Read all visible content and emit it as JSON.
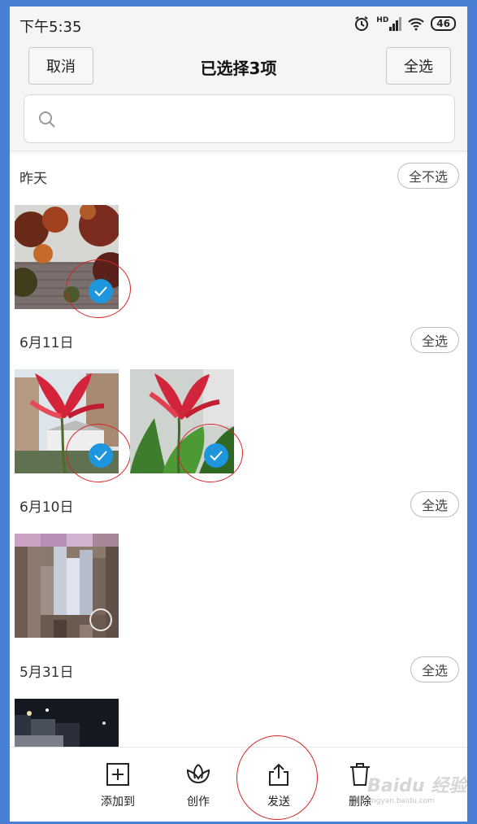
{
  "status": {
    "time": "下午5:35",
    "hd": "HD",
    "battery": "46"
  },
  "header": {
    "cancel": "取消",
    "title": "已选择3项",
    "select_all": "全选"
  },
  "search": {
    "placeholder": ""
  },
  "sections": [
    {
      "label": "昨天",
      "action": "全不选",
      "selected": [
        true
      ]
    },
    {
      "label": "6月11日",
      "action": "全选",
      "selected": [
        true,
        true
      ]
    },
    {
      "label": "6月10日",
      "action": "全选",
      "selected": [
        false
      ]
    },
    {
      "label": "5月31日",
      "action": "全选",
      "selected": []
    }
  ],
  "toolbar": {
    "add_to": "添加到",
    "create": "创作",
    "send": "发送",
    "delete": "删除"
  },
  "watermark": {
    "brand": "Baidu 经验",
    "url": "jingyan.baidu.com"
  },
  "colors": {
    "check": "#1e96de",
    "annotation": "#d62424",
    "background": "#4a7fd6"
  }
}
